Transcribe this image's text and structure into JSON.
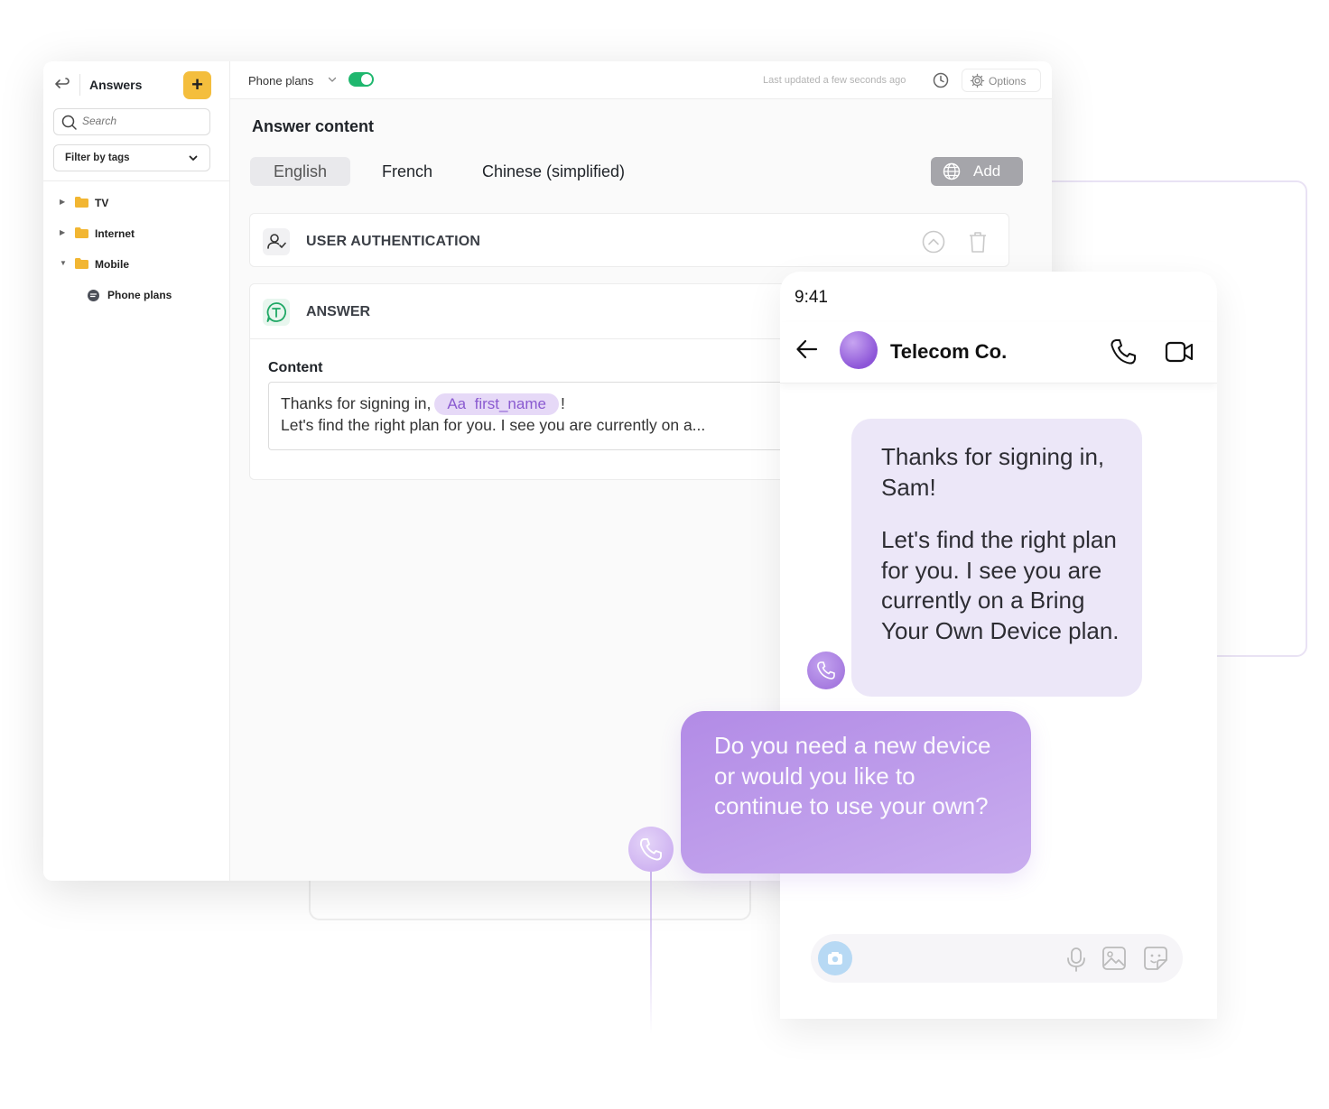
{
  "sidebar": {
    "title": "Answers",
    "add_label": "+",
    "search_placeholder": "Search",
    "filter_label": "Filter by tags",
    "tree": [
      {
        "label": "TV"
      },
      {
        "label": "Internet"
      },
      {
        "label": "Mobile"
      },
      {
        "label": "Phone plans"
      }
    ]
  },
  "topbar": {
    "title": "Phone plans",
    "last_updated": "Last updated a few seconds ago",
    "options_label": "Options",
    "toggle_on": true
  },
  "main": {
    "section_title": "Answer content",
    "languages": [
      "English",
      "French",
      "Chinese (simplified)"
    ],
    "add_label": "Add",
    "auth_label": "USER AUTHENTICATION",
    "answer_label": "ANSWER",
    "content_label": "Content",
    "content_line1_pre": "Thanks for signing in,",
    "chip_prefix": "Aa",
    "chip_var": "first_name",
    "content_line1_post": "!",
    "content_line2": "Let's find the right plan for you. I see you are currently on a..."
  },
  "phone": {
    "time": "9:41",
    "contact": "Telecom Co.",
    "message1_line1": "Thanks for signing in, Sam!",
    "message1_line2": "Let's find the right plan for you. I see you are currently on a Bring Your Own Device plan.",
    "message2": "Do you need a new device or would you like to continue to use your own?"
  },
  "colors": {
    "accent_yellow": "#f4be3d",
    "toggle_green": "#1fb76e",
    "chip_bg": "#e6d9f7",
    "bubble_in": "#ece7f8",
    "bubble_out": "#b28be6"
  }
}
